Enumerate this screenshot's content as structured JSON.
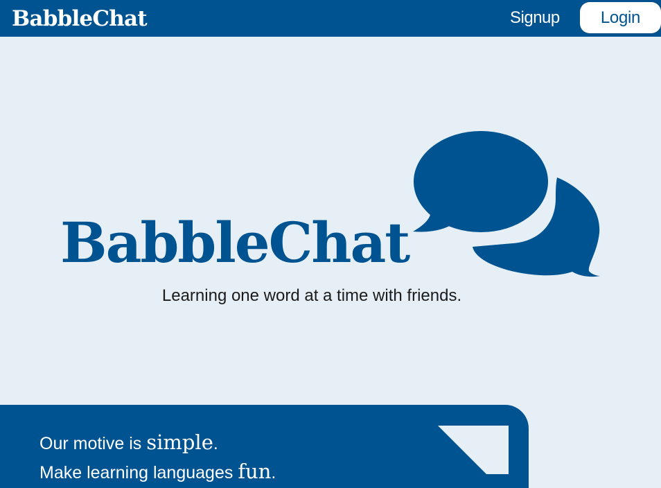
{
  "nav": {
    "brand": "BabbleChat",
    "signup_label": "Signup",
    "login_label": "Login"
  },
  "hero": {
    "logo_text": "BabbleChat",
    "tagline": "Learning one word at a time with friends."
  },
  "motive": {
    "line1_prefix": "Our motive is ",
    "line1_emphasis": "simple",
    "line1_suffix": ".",
    "line2_prefix": "Make learning languages ",
    "line2_emphasis": "fun",
    "line2_suffix": "."
  },
  "colors": {
    "brand_blue": "#005391",
    "background": "#e6eff6",
    "text_dark": "#1b1b1b",
    "white": "#ffffff"
  },
  "icons": {
    "hero_icon": "chat-bubbles-icon"
  }
}
